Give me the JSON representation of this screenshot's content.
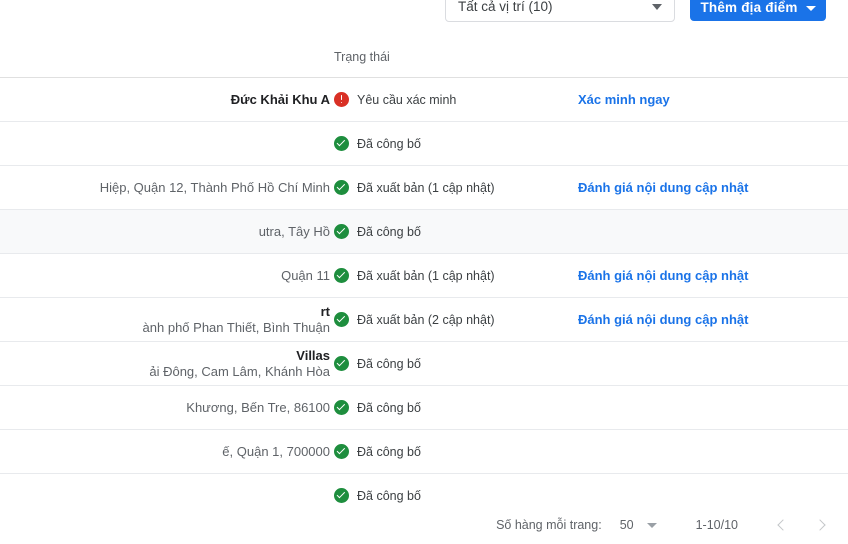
{
  "toolbar": {
    "location_filter_value": "Tất cả vị trí (10)",
    "add_location_label": "Thêm địa điểm"
  },
  "table": {
    "columns": {
      "name": "",
      "status": "Trạng thái",
      "action": ""
    },
    "rows": [
      {
        "name_title": "Đức Khải Khu A",
        "name_address": "",
        "status": "Yêu cầu xác minh",
        "status_icon": "error-icon",
        "action": "Xác minh ngay",
        "hovered": false
      },
      {
        "name_title": "",
        "name_address": "",
        "status": "Đã công bố",
        "status_icon": "check-circle-icon",
        "action": "",
        "hovered": false
      },
      {
        "name_title": "",
        "name_address": "Hiệp, Quận 12, Thành Phố Hồ Chí Minh",
        "status": "Đã xuất bản (1 cập nhật)",
        "status_icon": "check-circle-icon",
        "action": "Đánh giá nội dung cập nhật",
        "hovered": false
      },
      {
        "name_title": "",
        "name_address": "utra, Tây Hồ",
        "status": "Đã công bố",
        "status_icon": "check-circle-icon",
        "action": "",
        "hovered": true
      },
      {
        "name_title": "",
        "name_address": "Quận 11",
        "status": "Đã xuất bản (1 cập nhật)",
        "status_icon": "check-circle-icon",
        "action": "Đánh giá nội dung cập nhật",
        "hovered": false
      },
      {
        "name_title": "rt",
        "name_address": "ành phố Phan Thiết, Bình Thuận",
        "status": "Đã xuất bản (2 cập nhật)",
        "status_icon": "check-circle-icon",
        "action": "Đánh giá nội dung cập nhật",
        "hovered": false
      },
      {
        "name_title": " Villas",
        "name_address": "ải Đông, Cam Lâm, Khánh Hòa",
        "status": "Đã công bố",
        "status_icon": "check-circle-icon",
        "action": "",
        "hovered": false
      },
      {
        "name_title": "",
        "name_address": "Khương, Bến Tre, 86100",
        "status": "Đã công bố",
        "status_icon": "check-circle-icon",
        "action": "",
        "hovered": false
      },
      {
        "name_title": "",
        "name_address": "ế, Quận 1, 700000",
        "status": "Đã công bố",
        "status_icon": "check-circle-icon",
        "action": "",
        "hovered": false
      },
      {
        "name_title": "",
        "name_address": "",
        "status": "Đã công bố",
        "status_icon": "check-circle-icon",
        "action": "",
        "hovered": false
      }
    ]
  },
  "pagination": {
    "rows_per_page_label": "Số hàng mỗi trang:",
    "rows_per_page_value": "50",
    "range_label": "1-10/10"
  },
  "colors": {
    "accent_blue": "#1a73e8",
    "status_green": "#1e8e3e",
    "status_red": "#d93025",
    "row_hover": "#f8f9fa",
    "text_primary": "#3c4043",
    "text_secondary": "#5f6368"
  }
}
